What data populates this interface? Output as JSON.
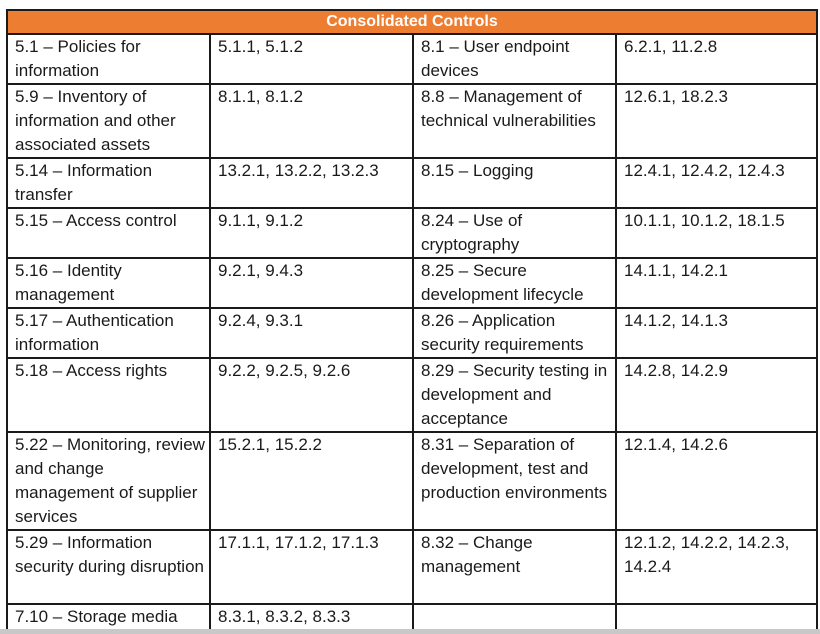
{
  "table": {
    "title": "Consolidated Controls",
    "header_color": "#ed7d31",
    "rows": [
      {
        "left_control": "5.1 – Policies for information",
        "left_mapping": "5.1.1, 5.1.2",
        "right_control": "8.1 – User endpoint devices",
        "right_mapping": "6.2.1, 11.2.8"
      },
      {
        "left_control": "5.9 – Inventory of information and other associated assets",
        "left_mapping": "8.1.1, 8.1.2",
        "right_control": "8.8 – Management of technical vulnerabilities",
        "right_mapping": "12.6.1, 18.2.3"
      },
      {
        "left_control": "5.14 – Information transfer",
        "left_mapping": "13.2.1, 13.2.2, 13.2.3",
        "right_control": "8.15 – Logging",
        "right_mapping": "12.4.1, 12.4.2, 12.4.3"
      },
      {
        "left_control": "5.15 – Access control",
        "left_mapping": "9.1.1, 9.1.2",
        "right_control": "8.24 – Use of cryptography",
        "right_mapping": "10.1.1, 10.1.2, 18.1.5"
      },
      {
        "left_control": "5.16 – Identity management",
        "left_mapping": "9.2.1, 9.4.3",
        "right_control": "8.25 – Secure development lifecycle",
        "right_mapping": "14.1.1, 14.2.1"
      },
      {
        "left_control": "5.17 – Authentication information",
        "left_mapping": "9.2.4, 9.3.1",
        "right_control": "8.26 – Application security requirements",
        "right_mapping": "14.1.2, 14.1.3"
      },
      {
        "left_control": "5.18 – Access rights",
        "left_mapping": "9.2.2, 9.2.5, 9.2.6",
        "right_control": "8.29 – Security testing in development and acceptance",
        "right_mapping": "14.2.8, 14.2.9"
      },
      {
        "left_control": "5.22 – Monitoring, review and change management of supplier services",
        "left_mapping": "15.2.1, 15.2.2",
        "right_control": "8.31 – Separation of development, test and production environments",
        "right_mapping": "12.1.4, 14.2.6"
      },
      {
        "left_control": "5.29 – Information security during disruption",
        "left_mapping": "17.1.1, 17.1.2, 17.1.3",
        "right_control": "8.32 – Change management",
        "right_mapping": "12.1.2, 14.2.2, 14.2.3, 14.2.4"
      },
      {
        "left_control": "7.10 – Storage media",
        "left_mapping": "8.3.1, 8.3.2, 8.3.3",
        "right_control": "",
        "right_mapping": ""
      }
    ]
  }
}
